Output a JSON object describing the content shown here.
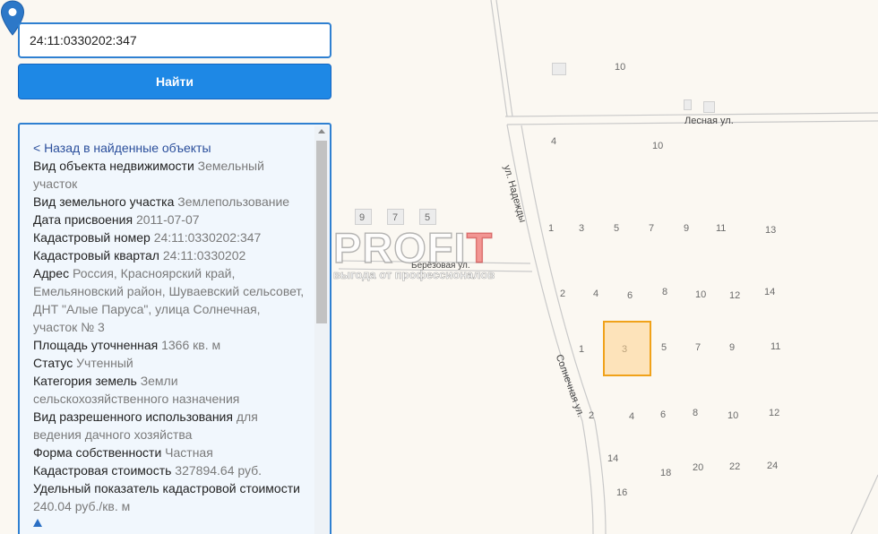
{
  "search": {
    "value": "24:11:0330202:347",
    "button_label": "Найти"
  },
  "info": {
    "back_link": "< Назад в найденные объекты",
    "rows": [
      {
        "label": "Вид объекта недвижимости",
        "value": "Земельный участок"
      },
      {
        "label": "Вид земельного участка",
        "value": "Землепользование"
      },
      {
        "label": "Дата присвоения",
        "value": "2011-07-07"
      },
      {
        "label": "Кадастровый номер",
        "value": "24:11:0330202:347"
      },
      {
        "label": "Кадастровый квартал",
        "value": "24:11:0330202"
      },
      {
        "label": "Адрес",
        "value": "Россия, Красноярский край, Емельяновский район, Шуваевский сельсовет, ДНТ \"Алые Паруса\", улица Солнечная, участок № 3"
      },
      {
        "label": "Площадь уточненная",
        "value": "1366 кв. м"
      },
      {
        "label": "Статус",
        "value": "Учтенный"
      },
      {
        "label": "Категория земель",
        "value": "Земли сельскохозяйственного назначения"
      },
      {
        "label": "Вид разрешенного использования",
        "value": "для ведения дачного хозяйства"
      },
      {
        "label": "Форма собственности",
        "value": "Частная"
      },
      {
        "label": "Кадастровая стоимость",
        "value": "327894.64 руб."
      },
      {
        "label": "Удельный показатель кадастровой стоимости",
        "value": "240.04 руб./кв. м"
      }
    ]
  },
  "map": {
    "streets": {
      "lesnaya": "Лесная ул.",
      "nadezhdy": "ул. Надежды",
      "berezovaya": "Берёзовая ул.",
      "solnechnaya": "Солнечная ул."
    },
    "house_numbers": [
      {
        "id": "10a",
        "text": "10"
      },
      {
        "id": "4a",
        "text": "4"
      },
      {
        "id": "10b",
        "text": "10"
      },
      {
        "id": "9a",
        "text": "9"
      },
      {
        "id": "7a",
        "text": "7"
      },
      {
        "id": "5a",
        "text": "5"
      },
      {
        "id": "1a",
        "text": "1"
      },
      {
        "id": "3a",
        "text": "3"
      },
      {
        "id": "5b",
        "text": "5"
      },
      {
        "id": "7b",
        "text": "7"
      },
      {
        "id": "9b",
        "text": "9"
      },
      {
        "id": "11a",
        "text": "11"
      },
      {
        "id": "13a",
        "text": "13"
      },
      {
        "id": "2a",
        "text": "2"
      },
      {
        "id": "4b",
        "text": "4"
      },
      {
        "id": "6a",
        "text": "6"
      },
      {
        "id": "8a",
        "text": "8"
      },
      {
        "id": "10c",
        "text": "10"
      },
      {
        "id": "12a",
        "text": "12"
      },
      {
        "id": "14a",
        "text": "14"
      },
      {
        "id": "1b",
        "text": "1"
      },
      {
        "id": "3b",
        "text": "3"
      },
      {
        "id": "5c",
        "text": "5"
      },
      {
        "id": "7c",
        "text": "7"
      },
      {
        "id": "9c",
        "text": "9"
      },
      {
        "id": "11b",
        "text": "11"
      },
      {
        "id": "2b",
        "text": "2"
      },
      {
        "id": "4c",
        "text": "4"
      },
      {
        "id": "6b",
        "text": "6"
      },
      {
        "id": "8b",
        "text": "8"
      },
      {
        "id": "10d",
        "text": "10"
      },
      {
        "id": "12b",
        "text": "12"
      },
      {
        "id": "14b",
        "text": "14"
      },
      {
        "id": "18a",
        "text": "18"
      },
      {
        "id": "20a",
        "text": "20"
      },
      {
        "id": "22a",
        "text": "22"
      },
      {
        "id": "24a",
        "text": "24"
      },
      {
        "id": "16a",
        "text": "16"
      }
    ]
  },
  "watermark": {
    "main_a": "PROFI",
    "main_b": "T",
    "sub": "выгода от профессионалов"
  },
  "colors": {
    "accent": "#1e88e5",
    "border": "#2f80d1",
    "parcel_border": "#f0a21a",
    "pin": "#2d78c8",
    "map_bg": "#fbf8f2"
  }
}
